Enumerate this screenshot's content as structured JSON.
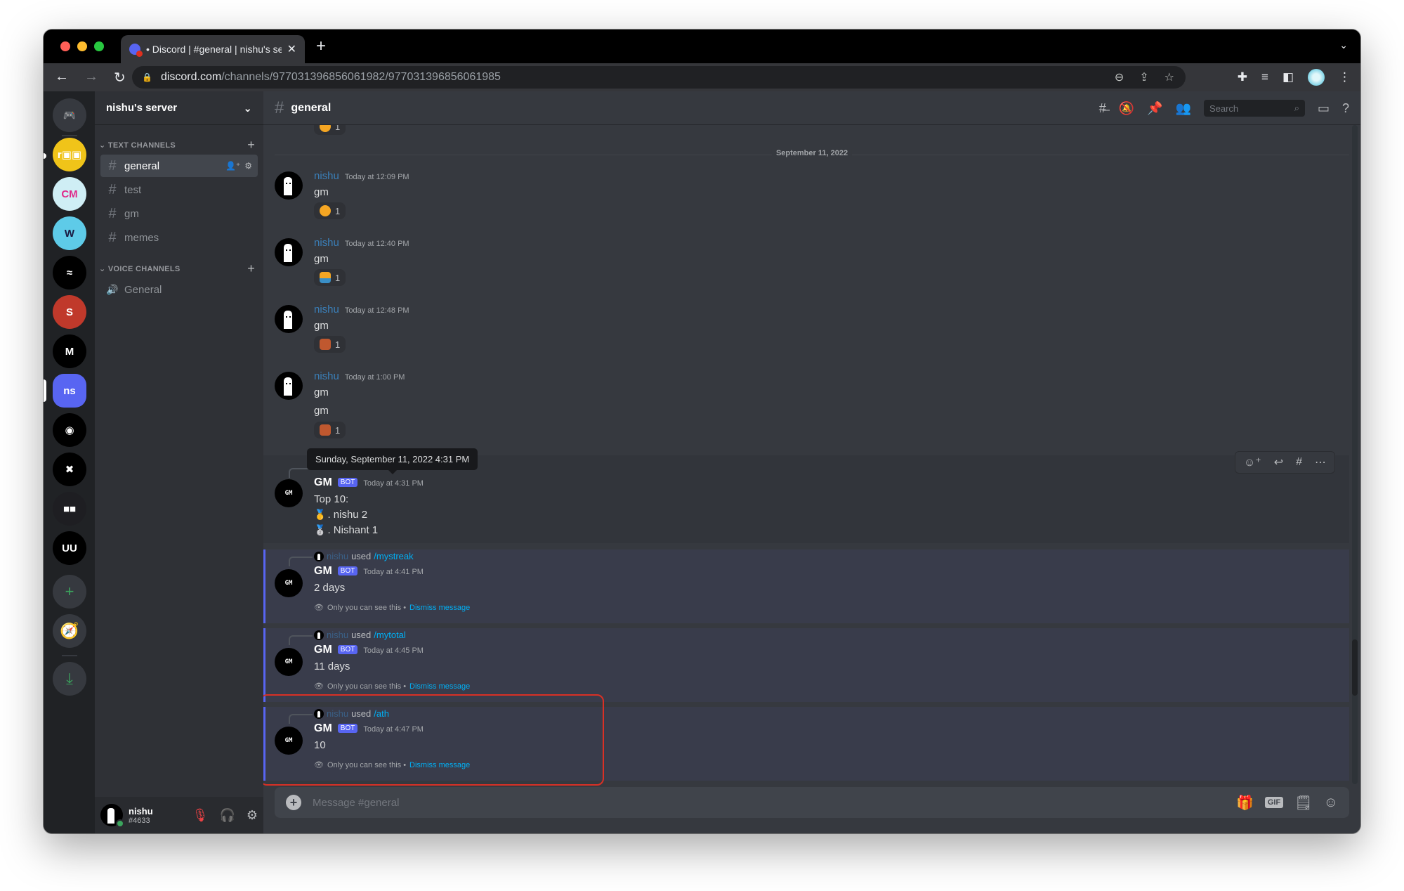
{
  "browser": {
    "tab_title": "• Discord | #general | nishu's se",
    "tab_close": "✕",
    "new_tab": "+",
    "url_host": "discord.com",
    "url_path": "/channels/977031396856061982/977031396856061985",
    "traffic_colors": [
      "#ff5f57",
      "#febc2e",
      "#28c840"
    ]
  },
  "servers": [
    {
      "name": "discord-home",
      "label": "",
      "color": "#36393f"
    },
    {
      "name": "server-roo",
      "label": "r▣▣",
      "color": "#f0c419"
    },
    {
      "name": "server-community-management",
      "label": "CM",
      "color": "#cfeef5"
    },
    {
      "name": "server-workshop",
      "label": "W",
      "color": "#5ecbe8"
    },
    {
      "name": "server-wave",
      "label": "≈",
      "color": "#000000"
    },
    {
      "name": "server-satoshi",
      "label": "S",
      "color": "#c0392b"
    },
    {
      "name": "server-m",
      "label": "M",
      "color": "#000000"
    },
    {
      "name": "server-ns",
      "label": "ns",
      "color": "#5865f2"
    },
    {
      "name": "server-eye",
      "label": "◉",
      "color": "#000000"
    },
    {
      "name": "server-x",
      "label": "✖",
      "color": "#000000"
    },
    {
      "name": "server-pixel",
      "label": "■■",
      "color": "#1e1e22"
    },
    {
      "name": "server-uu",
      "label": "UU",
      "color": "#000000"
    }
  ],
  "rail_actions": {
    "add": "+",
    "explore": "🧭",
    "download": "⤓"
  },
  "sidebar": {
    "server_name": "nishu's server",
    "text_category": "TEXT CHANNELS",
    "voice_category": "VOICE CHANNELS",
    "text_channels": [
      "general",
      "test",
      "gm",
      "memes"
    ],
    "voice_channels": [
      "General"
    ],
    "active_channel": "general"
  },
  "user": {
    "name": "nishu",
    "tag": "#4633",
    "status_color": "#3ba55d"
  },
  "header": {
    "channel": "general",
    "search_placeholder": "Search"
  },
  "date_divider": "September 11, 2022",
  "messages": [
    {
      "author": "nishu",
      "time": "Today at 12:09 PM",
      "lines": [
        "gm"
      ],
      "reaction": {
        "emoji": "sun",
        "count": "1",
        "color": "#f5a623"
      }
    },
    {
      "author": "nishu",
      "time": "Today at 12:40 PM",
      "lines": [
        "gm"
      ],
      "reaction": {
        "emoji": "sunrise",
        "count": "1",
        "color": "#3a8fc7"
      }
    },
    {
      "author": "nishu",
      "time": "Today at 12:48 PM",
      "lines": [
        "gm"
      ],
      "reaction": {
        "emoji": "face",
        "count": "1",
        "color": "#c0582f"
      }
    },
    {
      "author": "nishu",
      "time": "Today at 1:00 PM",
      "lines": [
        "gm",
        "gm"
      ],
      "reaction": {
        "emoji": "face",
        "count": "1",
        "color": "#c0582f"
      }
    }
  ],
  "top_message": {
    "author": "GM",
    "badge": "BOT",
    "time": "Today at 4:31 PM",
    "tooltip": "Sunday, September 11, 2022 4:31 PM",
    "lines": [
      "Top 10:",
      ". nishu 2",
      ". Nishant 1"
    ],
    "medals": [
      "🥇",
      "🥈"
    ]
  },
  "ephemeral": [
    {
      "user": "nishu",
      "used": "used",
      "command": "/mystreak",
      "author": "GM",
      "badge": "BOT",
      "time": "Today at 4:41 PM",
      "text": "2 days",
      "note": "Only you can see this •",
      "dismiss": "Dismiss message"
    },
    {
      "user": "nishu",
      "used": "used",
      "command": "/mytotal",
      "author": "GM",
      "badge": "BOT",
      "time": "Today at 4:45 PM",
      "text": "11 days",
      "note": "Only you can see this •",
      "dismiss": "Dismiss message"
    },
    {
      "user": "nishu",
      "used": "used",
      "command": "/ath",
      "author": "GM",
      "badge": "BOT",
      "time": "Today at 4:47 PM",
      "text": "10",
      "note": "Only you can see this •",
      "dismiss": "Dismiss message"
    }
  ],
  "composer": {
    "placeholder": "Message #general",
    "gif_label": "GIF"
  },
  "highlight_color": "#d93025"
}
